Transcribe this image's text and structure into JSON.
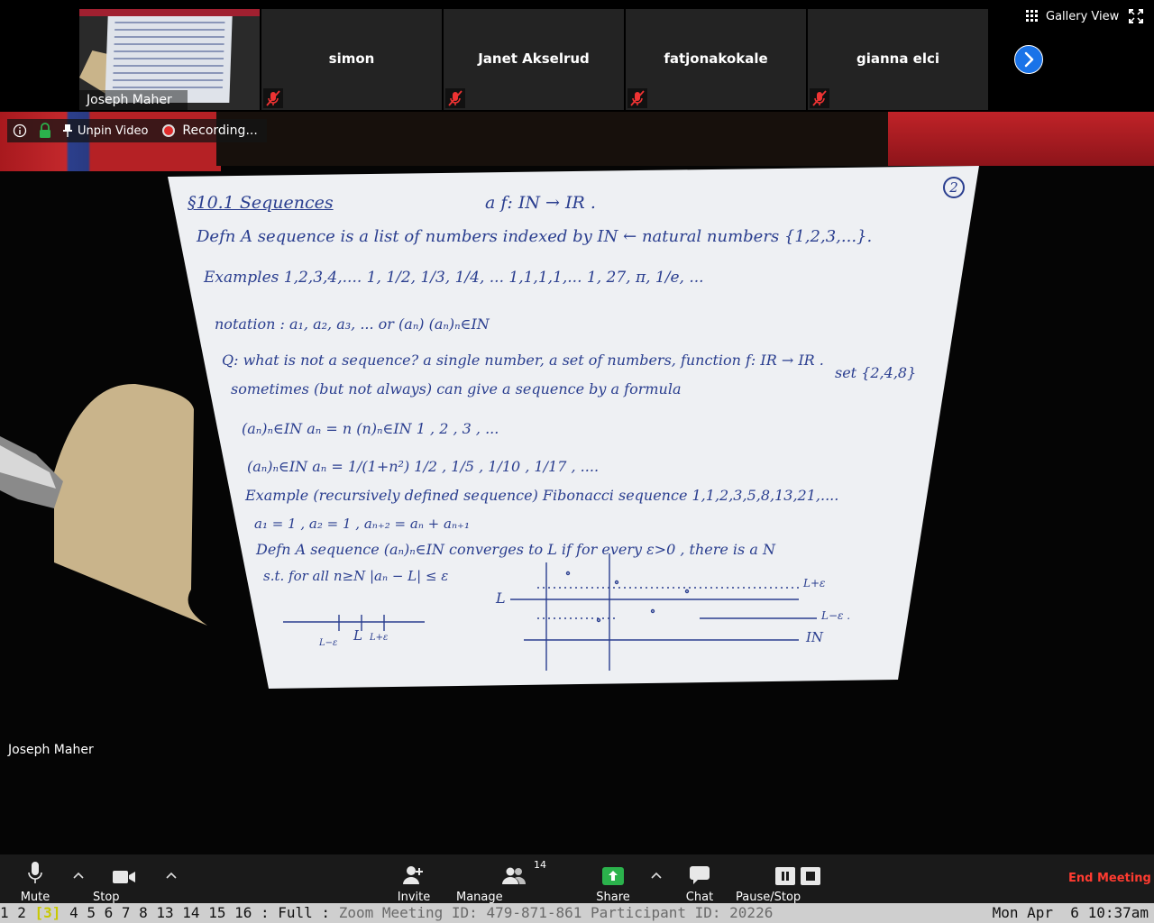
{
  "participants_strip": {
    "self_name": "Joseph Maher",
    "tiles": [
      {
        "name": "simon"
      },
      {
        "name": "Janet Akselrud"
      },
      {
        "name": "fatjonakokale"
      },
      {
        "name": "gianna elci"
      }
    ],
    "gallery_view_label": "Gallery View"
  },
  "video_controls": {
    "unpin_label": "Unpin Video",
    "recording_label": "Recording..."
  },
  "speaker_name": "Joseph Maher",
  "notes": {
    "page_number": "2",
    "title": "§10.1 Sequences",
    "line_map": "a f: IN → IR .",
    "defn": "Defn  A sequence is a list of numbers indexed by IN ← natural numbers {1,2,3,...}.",
    "examples": "Examples   1,2,3,4,....        1, 1/2, 1/3, 1/4, ...        1,1,1,1,...          1, 27, π, 1/e, ...",
    "notation": "notation :   a₁, a₂, a₃, ...        or  (aₙ)        (aₙ)ₙ∈IN",
    "question": "Q: what is not a sequence?  a single number, a set of numbers, function f: IR → IR .",
    "set_example": "set {2,4,8}",
    "sometimes": "sometimes (but not always) can give a sequence by a formula",
    "formula1": "(aₙ)ₙ∈IN     aₙ = n       (n)ₙ∈IN       1 , 2 , 3 , ...",
    "formula2": "(aₙ)ₙ∈IN     aₙ = 1/(1+n²)        1/2 , 1/5 , 1/10 , 1/17 , ....",
    "example_rec": "Example (recursively defined sequence)  Fibonacci sequence   1,1,2,3,5,8,13,21,....",
    "recurrence": "a₁ = 1 , a₂ = 1 ,  aₙ₊₂ = aₙ + aₙ₊₁",
    "defn2": "Defn  A sequence (aₙ)ₙ∈IN converges to L if for every ε>0 , there is a N",
    "st": "s.t. for all n≥N  |aₙ − L| ≤ ε",
    "graph_L": "L",
    "graph_Lplus": "L+ε",
    "graph_Lminus": "L−ε .",
    "graph_axis": "IN",
    "numberline_L": "L",
    "numberline_Lminus": "L−ε",
    "numberline_Lplus": "L+ε"
  },
  "toolbar": {
    "mute": "Mute",
    "stop_video": "Stop Video",
    "invite": "Invite",
    "manage_participants": "Manage Participants",
    "participant_count": "14",
    "share": "Share",
    "chat": "Chat",
    "pause_stop_recording": "Pause/Stop Recording",
    "end_meeting": "End Meeting"
  },
  "status_bar": {
    "windows_before": "1 2 ",
    "current_window": "[3]",
    "windows_after": " 4 5 6 7 8 13 14 15 16 : Full : ",
    "meeting_info": "Zoom Meeting ID: 479-871-861 Participant ID: 20226",
    "clock": "Mon Apr  6 10:37am"
  },
  "colors": {
    "ink": "#2a3e8f",
    "accent_blue": "#1a73e8",
    "end_meeting_red": "#ff3b30",
    "share_green": "#2bb24c"
  }
}
